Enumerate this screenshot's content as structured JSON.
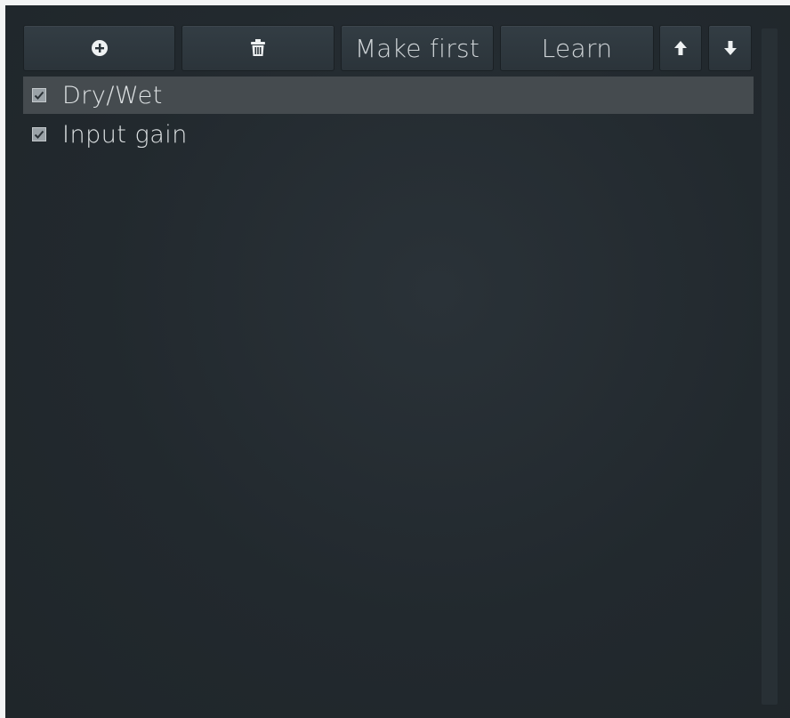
{
  "toolbar": {
    "add": {
      "icon": "plus-circle-icon"
    },
    "delete": {
      "icon": "trash-icon"
    },
    "make_first_label": "Make first",
    "learn_label": "Learn",
    "up": {
      "icon": "arrow-up-icon"
    },
    "down": {
      "icon": "arrow-down-icon"
    }
  },
  "parameters": [
    {
      "label": "Dry/Wet",
      "checked": true,
      "selected": true
    },
    {
      "label": "Input gain",
      "checked": true,
      "selected": false
    }
  ],
  "colors": {
    "background": "#22292e",
    "button": "#2f383e",
    "selected_row": "#454b4f",
    "text": "#dde1e3"
  }
}
